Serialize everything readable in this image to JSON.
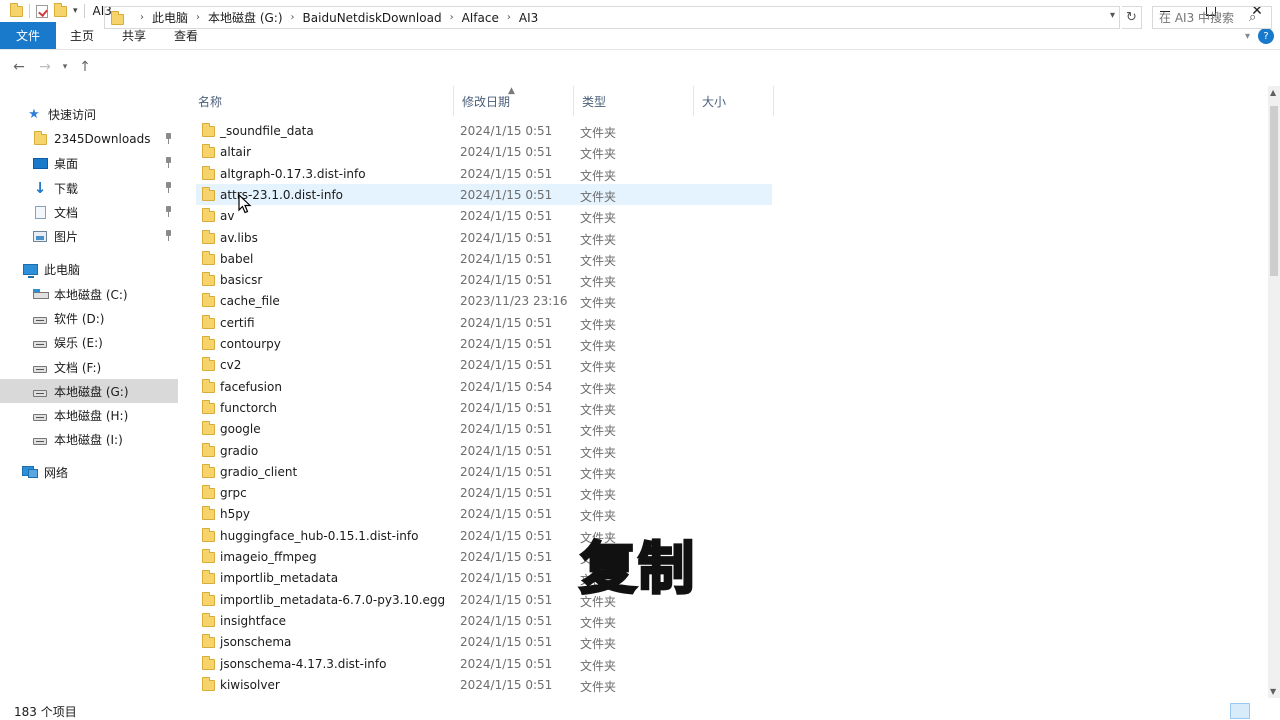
{
  "window": {
    "title": "AI3",
    "controls": {
      "minimize": "minimize",
      "maximize": "maximize",
      "close": "✕"
    }
  },
  "ribbon": {
    "tabs": [
      {
        "label": "文件",
        "active": true
      },
      {
        "label": "主页",
        "active": false
      },
      {
        "label": "共享",
        "active": false
      },
      {
        "label": "查看",
        "active": false
      }
    ],
    "help": "?"
  },
  "address": {
    "crumbs": [
      "此电脑",
      "本地磁盘 (G:)",
      "BaiduNetdiskDownload",
      "AIface",
      "AI3"
    ],
    "search_placeholder": "在 AI3 中搜索"
  },
  "sidebar": {
    "quick_access": {
      "label": "快速访问",
      "items": [
        {
          "label": "2345Downloads",
          "icon": "folder-icon",
          "pinned": true
        },
        {
          "label": "桌面",
          "icon": "desktop-icon",
          "pinned": true
        },
        {
          "label": "下载",
          "icon": "download-icon",
          "pinned": true
        },
        {
          "label": "文档",
          "icon": "document-icon",
          "pinned": true
        },
        {
          "label": "图片",
          "icon": "picture-icon",
          "pinned": true
        }
      ]
    },
    "this_pc": {
      "label": "此电脑",
      "drives": [
        {
          "label": "本地磁盘 (C:)",
          "selected": false
        },
        {
          "label": "软件 (D:)",
          "selected": false
        },
        {
          "label": "娱乐 (E:)",
          "selected": false
        },
        {
          "label": "文档 (F:)",
          "selected": false
        },
        {
          "label": "本地磁盘 (G:)",
          "selected": true
        },
        {
          "label": "本地磁盘 (H:)",
          "selected": false
        },
        {
          "label": "本地磁盘 (I:)",
          "selected": false
        }
      ]
    },
    "network": {
      "label": "网络"
    }
  },
  "columns": {
    "name": "名称",
    "modified": "修改日期",
    "type": "类型",
    "size": "大小"
  },
  "files": [
    {
      "name": "_soundfile_data",
      "date": "2024/1/15 0:51",
      "type": "文件夹"
    },
    {
      "name": "altair",
      "date": "2024/1/15 0:51",
      "type": "文件夹"
    },
    {
      "name": "altgraph-0.17.3.dist-info",
      "date": "2024/1/15 0:51",
      "type": "文件夹"
    },
    {
      "name": "attrs-23.1.0.dist-info",
      "date": "2024/1/15 0:51",
      "type": "文件夹",
      "hover": true
    },
    {
      "name": "av",
      "date": "2024/1/15 0:51",
      "type": "文件夹"
    },
    {
      "name": "av.libs",
      "date": "2024/1/15 0:51",
      "type": "文件夹"
    },
    {
      "name": "babel",
      "date": "2024/1/15 0:51",
      "type": "文件夹"
    },
    {
      "name": "basicsr",
      "date": "2024/1/15 0:51",
      "type": "文件夹"
    },
    {
      "name": "cache_file",
      "date": "2023/11/23 23:16",
      "type": "文件夹"
    },
    {
      "name": "certifi",
      "date": "2024/1/15 0:51",
      "type": "文件夹"
    },
    {
      "name": "contourpy",
      "date": "2024/1/15 0:51",
      "type": "文件夹"
    },
    {
      "name": "cv2",
      "date": "2024/1/15 0:51",
      "type": "文件夹"
    },
    {
      "name": "facefusion",
      "date": "2024/1/15 0:54",
      "type": "文件夹"
    },
    {
      "name": "functorch",
      "date": "2024/1/15 0:51",
      "type": "文件夹"
    },
    {
      "name": "google",
      "date": "2024/1/15 0:51",
      "type": "文件夹"
    },
    {
      "name": "gradio",
      "date": "2024/1/15 0:51",
      "type": "文件夹"
    },
    {
      "name": "gradio_client",
      "date": "2024/1/15 0:51",
      "type": "文件夹"
    },
    {
      "name": "grpc",
      "date": "2024/1/15 0:51",
      "type": "文件夹"
    },
    {
      "name": "h5py",
      "date": "2024/1/15 0:51",
      "type": "文件夹"
    },
    {
      "name": "huggingface_hub-0.15.1.dist-info",
      "date": "2024/1/15 0:51",
      "type": "文件夹"
    },
    {
      "name": "imageio_ffmpeg",
      "date": "2024/1/15 0:51",
      "type": "文件夹"
    },
    {
      "name": "importlib_metadata",
      "date": "2024/1/15 0:51",
      "type": "文件夹"
    },
    {
      "name": "importlib_metadata-6.7.0-py3.10.egg",
      "date": "2024/1/15 0:51",
      "type": "文件夹"
    },
    {
      "name": "insightface",
      "date": "2024/1/15 0:51",
      "type": "文件夹"
    },
    {
      "name": "jsonschema",
      "date": "2024/1/15 0:51",
      "type": "文件夹"
    },
    {
      "name": "jsonschema-4.17.3.dist-info",
      "date": "2024/1/15 0:51",
      "type": "文件夹"
    },
    {
      "name": "kiwisolver",
      "date": "2024/1/15 0:51",
      "type": "文件夹"
    }
  ],
  "status": {
    "count": "183 个项目"
  },
  "overlay": {
    "subtitle": "复制"
  },
  "colors": {
    "accent": "#1979ca",
    "hover_row": "#e5f3ff",
    "selected_drive": "#d9d9d9"
  }
}
